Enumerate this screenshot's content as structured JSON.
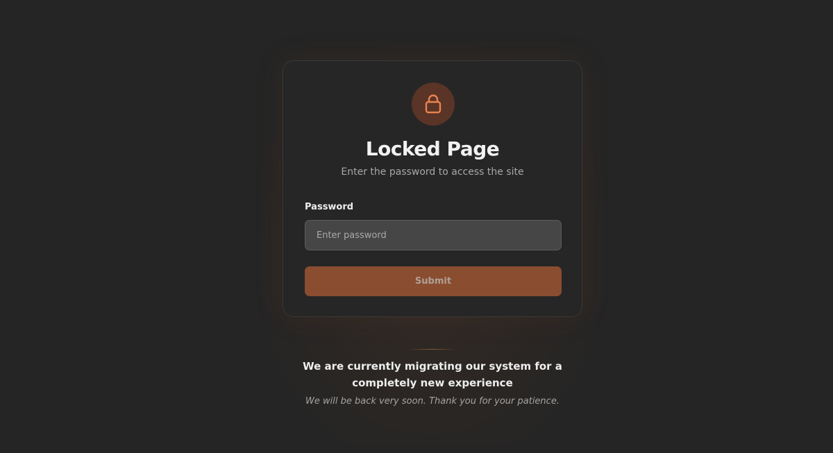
{
  "card": {
    "title": "Locked Page",
    "subtitle": "Enter the password to access the site",
    "lock_icon": "lock-icon",
    "password_label": "Password",
    "password_placeholder": "Enter password",
    "password_value": "",
    "submit_label": "Submit"
  },
  "footer": {
    "migration_message": "We are currently migrating our system for a completely new experience",
    "patience_message": "We will be back very soon. Thank you for your patience."
  },
  "colors": {
    "background": "#252525",
    "card_background": "#262626",
    "accent": "#8a4d30",
    "lock_circle": "#5a3426",
    "lock_icon": "#e9834f"
  }
}
